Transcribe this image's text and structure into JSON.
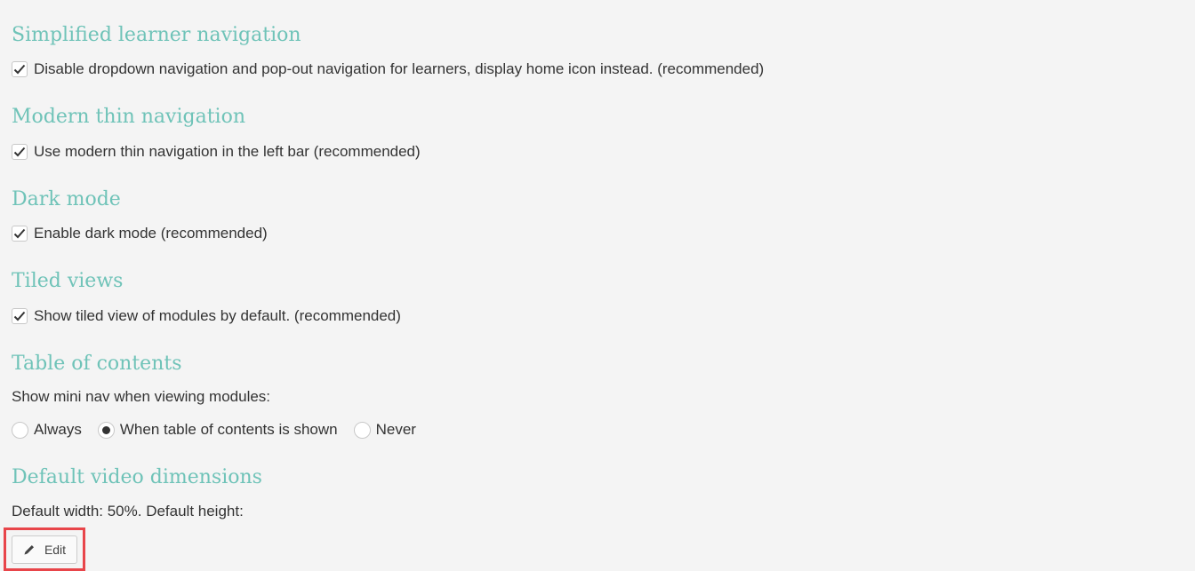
{
  "sections": {
    "simplified": {
      "title": "Simplified learner navigation",
      "checkbox_label": "Disable dropdown navigation and pop-out navigation for learners, display home icon instead. (recommended)",
      "checked": true
    },
    "modern_thin": {
      "title": "Modern thin navigation",
      "checkbox_label": "Use modern thin navigation in the left bar (recommended)",
      "checked": true
    },
    "dark_mode": {
      "title": "Dark mode",
      "checkbox_label": "Enable dark mode (recommended)",
      "checked": true
    },
    "tiled_views": {
      "title": "Tiled views",
      "checkbox_label": "Show tiled view of modules by default. (recommended)",
      "checked": true
    },
    "toc": {
      "title": "Table of contents",
      "prompt": "Show mini nav when viewing modules:",
      "options": [
        {
          "label": "Always",
          "selected": false
        },
        {
          "label": "When table of contents is shown",
          "selected": true
        },
        {
          "label": "Never",
          "selected": false
        }
      ]
    },
    "video": {
      "title": "Default video dimensions",
      "description": "Default width: 50%. Default height:",
      "edit_label": "Edit"
    }
  },
  "colors": {
    "heading": "#6fc3b8",
    "highlight": "#e8454a",
    "background": "#f4f4f4"
  },
  "icons": {
    "checkbox_checked": "check-icon",
    "radio_selected": "radio-dot",
    "edit": "pencil-icon"
  }
}
